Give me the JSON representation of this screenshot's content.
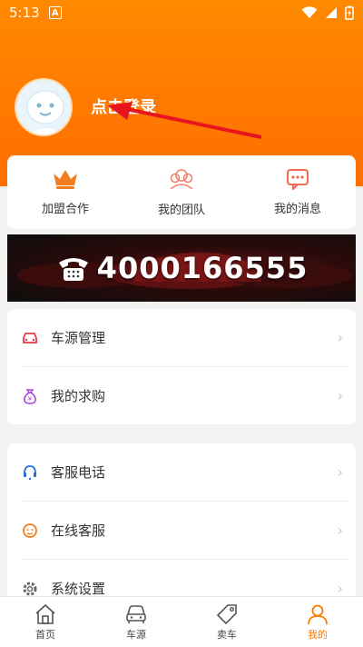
{
  "status_bar": {
    "time": "5:13",
    "notification_letter": "A"
  },
  "profile": {
    "login_text": "点击登录"
  },
  "quick_actions": [
    {
      "label": "加盟合作",
      "icon": "crown-icon"
    },
    {
      "label": "我的团队",
      "icon": "team-icon"
    },
    {
      "label": "我的消息",
      "icon": "message-icon"
    }
  ],
  "banner": {
    "phone": "4000166555"
  },
  "menu_group_1": [
    {
      "label": "车源管理",
      "icon": "car-icon"
    },
    {
      "label": "我的求购",
      "icon": "money-bag-icon"
    }
  ],
  "menu_group_2": [
    {
      "label": "客服电话",
      "icon": "headset-icon"
    },
    {
      "label": "在线客服",
      "icon": "service-face-icon"
    },
    {
      "label": "系统设置",
      "icon": "gear-icon"
    }
  ],
  "bottom_nav": [
    {
      "label": "首页",
      "icon": "home-icon",
      "active": false
    },
    {
      "label": "车源",
      "icon": "car-outline-icon",
      "active": false
    },
    {
      "label": "卖车",
      "icon": "tag-icon",
      "active": false
    },
    {
      "label": "我的",
      "icon": "person-icon",
      "active": true
    }
  ],
  "colors": {
    "accent": "#ff7a00",
    "header": "#ff8000"
  }
}
